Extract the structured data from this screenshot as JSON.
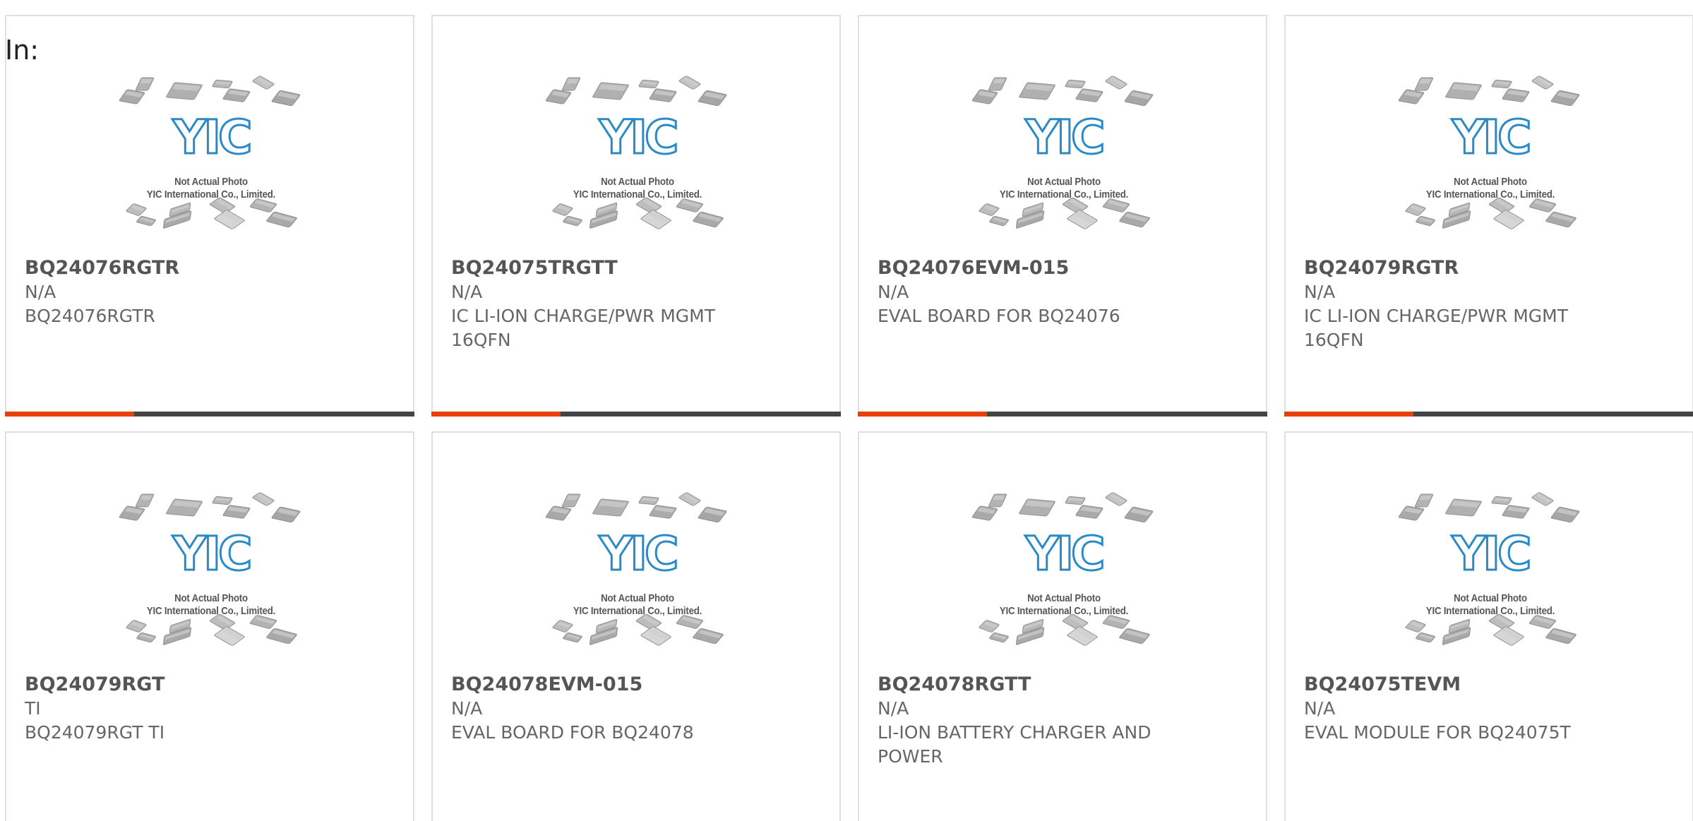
{
  "header": {
    "in_label": "In:"
  },
  "thumbnail": {
    "caption_line1": "Not Actual Photo",
    "caption_line2": "YIC International Co., Limited.",
    "logo_text": "YIC",
    "logo_color": "#2a8ac8"
  },
  "colors": {
    "accent": "#e8400a",
    "bar": "#444444",
    "border": "#e0e0e0"
  },
  "products": [
    {
      "part": "BQ24076RGTR",
      "manufacturer": "N/A",
      "description": "BQ24076RGTR"
    },
    {
      "part": "BQ24075TRGTT",
      "manufacturer": "N/A",
      "description": "IC LI-ION CHARGE/PWR MGMT 16QFN"
    },
    {
      "part": "BQ24076EVM-015",
      "manufacturer": "N/A",
      "description": "EVAL BOARD FOR BQ24076"
    },
    {
      "part": "BQ24079RGTR",
      "manufacturer": "N/A",
      "description": "IC LI-ION CHARGE/PWR MGMT 16QFN"
    },
    {
      "part": "BQ24079RGT",
      "manufacturer": "TI",
      "description": "BQ24079RGT TI"
    },
    {
      "part": "BQ24078EVM-015",
      "manufacturer": "N/A",
      "description": "EVAL BOARD FOR BQ24078"
    },
    {
      "part": "BQ24078RGTT",
      "manufacturer": "N/A",
      "description": "LI-ION BATTERY CHARGER AND POWER"
    },
    {
      "part": "BQ24075TEVM",
      "manufacturer": "N/A",
      "description": "EVAL MODULE FOR BQ24075T"
    }
  ]
}
